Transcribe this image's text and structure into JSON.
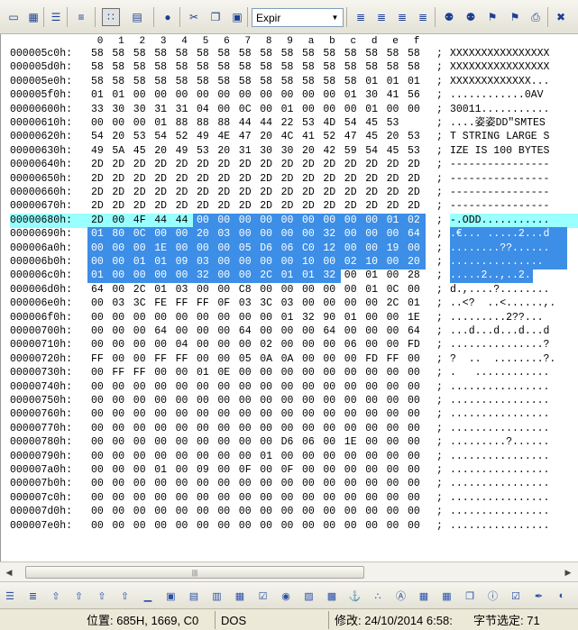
{
  "toolbar": {
    "search_combo_value": "Expir",
    "buttons_left": [
      {
        "name": "new-file-icon",
        "glyph": "▭"
      },
      {
        "name": "open-file-icon",
        "glyph": "▦"
      },
      {
        "name": "page-icon",
        "glyph": "☰"
      },
      {
        "name": "lines-icon",
        "glyph": "≡"
      },
      {
        "name": "hex-mode-icon",
        "glyph": "∷"
      },
      {
        "name": "document-icon",
        "glyph": "▤"
      },
      {
        "name": "globe-icon",
        "glyph": "●"
      },
      {
        "name": "cut-icon",
        "glyph": "✂"
      },
      {
        "name": "copy-icon",
        "glyph": "❐"
      },
      {
        "name": "paste-icon",
        "glyph": "▣"
      }
    ],
    "buttons_right": [
      {
        "name": "align-left-icon",
        "glyph": "≣"
      },
      {
        "name": "align-center-icon",
        "glyph": "≣"
      },
      {
        "name": "align-right-icon",
        "glyph": "≣"
      },
      {
        "name": "justify-icon",
        "glyph": "≣"
      },
      {
        "name": "find-icon",
        "glyph": "⚉"
      },
      {
        "name": "find-next-icon",
        "glyph": "⚉"
      },
      {
        "name": "bookmark-add-icon",
        "glyph": "⚑"
      },
      {
        "name": "bookmark-next-icon",
        "glyph": "⚑"
      },
      {
        "name": "print-icon",
        "glyph": "⎙"
      },
      {
        "name": "close-icon",
        "glyph": "✖"
      }
    ]
  },
  "hex_header": [
    "0",
    "1",
    "2",
    "3",
    "4",
    "5",
    "6",
    "7",
    "8",
    "9",
    "a",
    "b",
    "c",
    "d",
    "e",
    "f"
  ],
  "rows": [
    {
      "addr": "000005c0h:",
      "hex": [
        "58",
        "58",
        "58",
        "58",
        "58",
        "58",
        "58",
        "58",
        "58",
        "58",
        "58",
        "58",
        "58",
        "58",
        "58",
        "58"
      ],
      "ascii": "XXXXXXXXXXXXXXXX"
    },
    {
      "addr": "000005d0h:",
      "hex": [
        "58",
        "58",
        "58",
        "58",
        "58",
        "58",
        "58",
        "58",
        "58",
        "58",
        "58",
        "58",
        "58",
        "58",
        "58",
        "58"
      ],
      "ascii": "XXXXXXXXXXXXXXXX"
    },
    {
      "addr": "000005e0h:",
      "hex": [
        "58",
        "58",
        "58",
        "58",
        "58",
        "58",
        "58",
        "58",
        "58",
        "58",
        "58",
        "58",
        "58",
        "01",
        "01",
        "01"
      ],
      "ascii": "XXXXXXXXXXXXX..."
    },
    {
      "addr": "000005f0h:",
      "hex": [
        "01",
        "01",
        "00",
        "00",
        "00",
        "00",
        "00",
        "00",
        "00",
        "00",
        "00",
        "00",
        "01",
        "30",
        "41",
        "56"
      ],
      "ascii": "............0AV"
    },
    {
      "addr": "00000600h:",
      "hex": [
        "33",
        "30",
        "30",
        "31",
        "31",
        "04",
        "00",
        "0C",
        "00",
        "01",
        "00",
        "00",
        "00",
        "01",
        "00",
        "00"
      ],
      "ascii": "30011..........."
    },
    {
      "addr": "00000610h:",
      "hex": [
        "00",
        "00",
        "00",
        "01",
        "88",
        "88",
        "88",
        "44",
        "44",
        "22",
        "53",
        "4D",
        "54",
        "45",
        "53"
      ],
      "ascii": "....姿姿DD\"SMTES"
    },
    {
      "addr": "00000620h:",
      "hex": [
        "54",
        "20",
        "53",
        "54",
        "52",
        "49",
        "4E",
        "47",
        "20",
        "4C",
        "41",
        "52",
        "47",
        "45",
        "20",
        "53"
      ],
      "ascii": "T STRING LARGE S"
    },
    {
      "addr": "00000630h:",
      "hex": [
        "49",
        "5A",
        "45",
        "20",
        "49",
        "53",
        "20",
        "31",
        "30",
        "30",
        "20",
        "42",
        "59",
        "54",
        "45",
        "53"
      ],
      "ascii": "IZE IS 100 BYTES"
    },
    {
      "addr": "00000640h:",
      "hex": [
        "2D",
        "2D",
        "2D",
        "2D",
        "2D",
        "2D",
        "2D",
        "2D",
        "2D",
        "2D",
        "2D",
        "2D",
        "2D",
        "2D",
        "2D",
        "2D"
      ],
      "ascii": "----------------"
    },
    {
      "addr": "00000650h:",
      "hex": [
        "2D",
        "2D",
        "2D",
        "2D",
        "2D",
        "2D",
        "2D",
        "2D",
        "2D",
        "2D",
        "2D",
        "2D",
        "2D",
        "2D",
        "2D",
        "2D"
      ],
      "ascii": "----------------"
    },
    {
      "addr": "00000660h:",
      "hex": [
        "2D",
        "2D",
        "2D",
        "2D",
        "2D",
        "2D",
        "2D",
        "2D",
        "2D",
        "2D",
        "2D",
        "2D",
        "2D",
        "2D",
        "2D",
        "2D"
      ],
      "ascii": "----------------"
    },
    {
      "addr": "00000670h:",
      "hex": [
        "2D",
        "2D",
        "2D",
        "2D",
        "2D",
        "2D",
        "2D",
        "2D",
        "2D",
        "2D",
        "2D",
        "2D",
        "2D",
        "2D",
        "2D",
        "2D"
      ],
      "ascii": "----------------"
    },
    {
      "addr": "00000680h:",
      "hex": [
        "2D",
        "00",
        "4F",
        "44",
        "44",
        "00",
        "00",
        "00",
        "00",
        "00",
        "00",
        "00",
        "00",
        "00",
        "01",
        "02"
      ],
      "ascii": "-.ODD..........."
    },
    {
      "addr": "00000690h:",
      "hex": [
        "01",
        "80",
        "0C",
        "00",
        "00",
        "20",
        "03",
        "00",
        "00",
        "00",
        "00",
        "32",
        "00",
        "00",
        "00",
        "64"
      ],
      "ascii": ".€... .....2...d"
    },
    {
      "addr": "000006a0h:",
      "hex": [
        "00",
        "00",
        "00",
        "1E",
        "00",
        "00",
        "00",
        "05",
        "D6",
        "06",
        "C0",
        "12",
        "00",
        "00",
        "19",
        "00"
      ],
      "ascii": "........??......"
    },
    {
      "addr": "000006b0h:",
      "hex": [
        "00",
        "00",
        "01",
        "01",
        "09",
        "03",
        "00",
        "00",
        "00",
        "00",
        "10",
        "00",
        "02",
        "10",
        "00",
        "20"
      ],
      "ascii": "............... "
    },
    {
      "addr": "000006c0h:",
      "hex": [
        "01",
        "00",
        "00",
        "00",
        "00",
        "32",
        "00",
        "00",
        "2C",
        "01",
        "01",
        "32",
        "00",
        "01",
        "00",
        "28"
      ],
      "ascii": ".....2..,..2...("
    },
    {
      "addr": "000006d0h:",
      "hex": [
        "64",
        "00",
        "2C",
        "01",
        "03",
        "00",
        "00",
        "C8",
        "00",
        "00",
        "00",
        "00",
        "00",
        "01",
        "0C",
        "00"
      ],
      "ascii": "d.,....?........"
    },
    {
      "addr": "000006e0h:",
      "hex": [
        "00",
        "03",
        "3C",
        "FE",
        "FF",
        "FF",
        "0F",
        "03",
        "3C",
        "03",
        "00",
        "00",
        "00",
        "00",
        "2C",
        "01"
      ],
      "ascii": "..<?  ..<......,."
    },
    {
      "addr": "000006f0h:",
      "hex": [
        "00",
        "00",
        "00",
        "00",
        "00",
        "00",
        "00",
        "00",
        "00",
        "01",
        "32",
        "90",
        "01",
        "00",
        "00",
        "1E"
      ],
      "ascii": ".........2??..."
    },
    {
      "addr": "00000700h:",
      "hex": [
        "00",
        "00",
        "00",
        "64",
        "00",
        "00",
        "00",
        "64",
        "00",
        "00",
        "00",
        "64",
        "00",
        "00",
        "00",
        "64"
      ],
      "ascii": "...d...d...d...d"
    },
    {
      "addr": "00000710h:",
      "hex": [
        "00",
        "00",
        "00",
        "00",
        "04",
        "00",
        "00",
        "00",
        "02",
        "00",
        "00",
        "00",
        "06",
        "00",
        "00",
        "FD"
      ],
      "ascii": "...............?"
    },
    {
      "addr": "00000720h:",
      "hex": [
        "FF",
        "00",
        "00",
        "FF",
        "FF",
        "00",
        "00",
        "05",
        "0A",
        "0A",
        "00",
        "00",
        "00",
        "FD",
        "FF",
        "00"
      ],
      "ascii": "?  ..  ........?."
    },
    {
      "addr": "00000730h:",
      "hex": [
        "00",
        "FF",
        "FF",
        "00",
        "00",
        "01",
        "0E",
        "00",
        "00",
        "00",
        "00",
        "00",
        "00",
        "00",
        "00",
        "00"
      ],
      "ascii": ".   ............"
    },
    {
      "addr": "00000740h:",
      "hex": [
        "00",
        "00",
        "00",
        "00",
        "00",
        "00",
        "00",
        "00",
        "00",
        "00",
        "00",
        "00",
        "00",
        "00",
        "00",
        "00"
      ],
      "ascii": "................"
    },
    {
      "addr": "00000750h:",
      "hex": [
        "00",
        "00",
        "00",
        "00",
        "00",
        "00",
        "00",
        "00",
        "00",
        "00",
        "00",
        "00",
        "00",
        "00",
        "00",
        "00"
      ],
      "ascii": "................"
    },
    {
      "addr": "00000760h:",
      "hex": [
        "00",
        "00",
        "00",
        "00",
        "00",
        "00",
        "00",
        "00",
        "00",
        "00",
        "00",
        "00",
        "00",
        "00",
        "00",
        "00"
      ],
      "ascii": "................"
    },
    {
      "addr": "00000770h:",
      "hex": [
        "00",
        "00",
        "00",
        "00",
        "00",
        "00",
        "00",
        "00",
        "00",
        "00",
        "00",
        "00",
        "00",
        "00",
        "00",
        "00"
      ],
      "ascii": "................"
    },
    {
      "addr": "00000780h:",
      "hex": [
        "00",
        "00",
        "00",
        "00",
        "00",
        "00",
        "00",
        "00",
        "00",
        "D6",
        "06",
        "00",
        "1E",
        "00",
        "00",
        "00"
      ],
      "ascii": ".........?......"
    },
    {
      "addr": "00000790h:",
      "hex": [
        "00",
        "00",
        "00",
        "00",
        "00",
        "00",
        "00",
        "00",
        "01",
        "00",
        "00",
        "00",
        "00",
        "00",
        "00",
        "00"
      ],
      "ascii": "................"
    },
    {
      "addr": "000007a0h:",
      "hex": [
        "00",
        "00",
        "00",
        "01",
        "00",
        "09",
        "00",
        "0F",
        "00",
        "0F",
        "00",
        "00",
        "00",
        "00",
        "00",
        "00"
      ],
      "ascii": "................"
    },
    {
      "addr": "000007b0h:",
      "hex": [
        "00",
        "00",
        "00",
        "00",
        "00",
        "00",
        "00",
        "00",
        "00",
        "00",
        "00",
        "00",
        "00",
        "00",
        "00",
        "00"
      ],
      "ascii": "................"
    },
    {
      "addr": "000007c0h:",
      "hex": [
        "00",
        "00",
        "00",
        "00",
        "00",
        "00",
        "00",
        "00",
        "00",
        "00",
        "00",
        "00",
        "00",
        "00",
        "00",
        "00"
      ],
      "ascii": "................"
    },
    {
      "addr": "000007d0h:",
      "hex": [
        "00",
        "00",
        "00",
        "00",
        "00",
        "00",
        "00",
        "00",
        "00",
        "00",
        "00",
        "00",
        "00",
        "00",
        "00",
        "00"
      ],
      "ascii": "................"
    },
    {
      "addr": "000007e0h:",
      "hex": [
        "00",
        "00",
        "00",
        "00",
        "00",
        "00",
        "00",
        "00",
        "00",
        "00",
        "00",
        "00",
        "00",
        "00",
        "00",
        "00"
      ],
      "ascii": "................"
    }
  ],
  "selection": {
    "row_light": 12,
    "light_cols_end": 4,
    "dark_start": {
      "row": 12,
      "col": 5
    },
    "dark_end": {
      "row": 16,
      "col": 11
    }
  },
  "colors": {
    "selection_light": "#99ffff",
    "selection_dark": "#3d8ee6"
  },
  "bottom_toolbar_icons": [
    "indent-icon",
    "align-icon",
    "text-a-icon",
    "text-b-icon",
    "text-c-icon",
    "text-d-icon",
    "underline-icon",
    "abl-field-icon",
    "field-icon",
    "field-xy-icon",
    "list-icon",
    "checkbox-icon",
    "radio-icon",
    "image-icon",
    "picture-icon",
    "anchor-icon",
    "symbol-icon",
    "font-icon",
    "table-icon",
    "grid-icon",
    "copy-format-icon",
    "id-icon",
    "checklist-icon",
    "pen-icon",
    "color-icon"
  ],
  "statusbar": {
    "position": "位置: 685H, 1669, C0",
    "mode": "DOS",
    "modified": "修改: 24/10/2014 6:58:",
    "selected": "字节选定: 71"
  }
}
